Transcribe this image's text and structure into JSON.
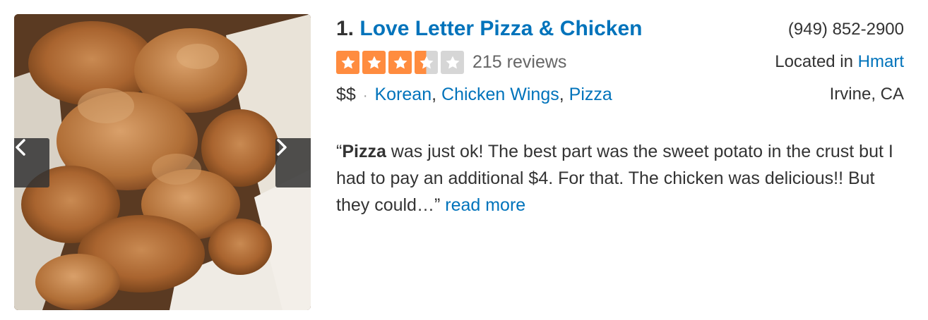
{
  "photo": {
    "alt": "Fried chicken pieces in paper-lined basket",
    "prev_icon": "chevron-left-icon",
    "next_icon": "chevron-right-icon"
  },
  "business": {
    "index": "1.",
    "name": "Love Letter Pizza & Chicken",
    "phone": "(949) 852-2900",
    "located_prefix": "Located in ",
    "located_link": "Hmart",
    "city": "Irvine, CA"
  },
  "rating": {
    "value": 3.5,
    "max": 5,
    "review_count": "215 reviews",
    "star_color": "#ff8c3f",
    "empty_color": "#d6d6d6"
  },
  "meta": {
    "price": "$$",
    "dot": "·",
    "categories": [
      "Korean",
      "Chicken Wings",
      "Pizza"
    ],
    "separator": ", "
  },
  "snippet": {
    "open_quote": "“",
    "highlight": "Pizza",
    "text": " was just ok! The best part was the sweet potato in the crust but I had to pay an additional $4. For that. The chicken was delicious!! But they could…” ",
    "read_more": "read more"
  },
  "colors": {
    "link": "#0073bb",
    "text": "#333333"
  }
}
